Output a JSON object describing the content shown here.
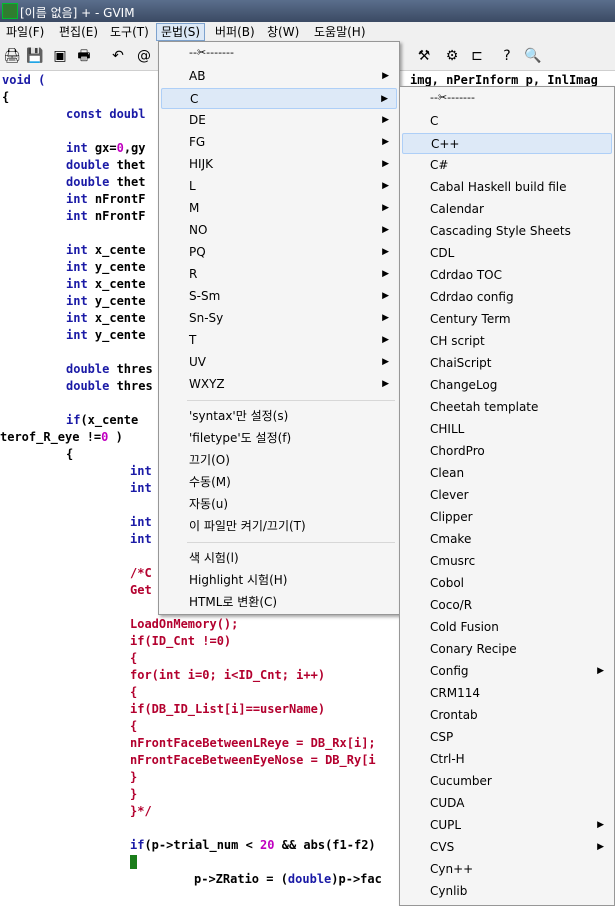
{
  "window": {
    "title": "[이름 없음] + - GVIM"
  },
  "menubar": [
    "파일(F)",
    "편집(E)",
    "도구(T)",
    "문법(S)",
    "버퍼(B)",
    "창(W)",
    "도움말(H)"
  ],
  "toolbar_icons": [
    "open-icon",
    "save-icon",
    "save-all-icon",
    "print-icon",
    "undo-icon",
    "redo-icon",
    "build-icon",
    "run-ctags-icon",
    "tag-jump-icon",
    "help-icon",
    "find-help-icon"
  ],
  "code": {
    "l1a": "void (",
    "l1b": "img, nPerInform p, InlImag",
    "l2": "{",
    "l3a": "const doubl",
    "l4a": "int",
    "l4b": " gx=",
    "l4c": "0",
    "l4d": ",gy",
    "l5a": "double",
    "l5b": " thet",
    "l6a": "double",
    "l6b": " thet",
    "l7a": "int",
    "l7b": " nFrontF",
    "l8a": "int",
    "l8b": " nFrontF",
    "l9a": "int",
    "l9b": " x_cente",
    "l10a": "int",
    "l10b": " y_cente",
    "l11a": "int",
    "l11b": " x_cente",
    "l12a": "int",
    "l12b": " y_cente",
    "l13a": "int",
    "l13b": " x_cente",
    "l14a": "int",
    "l14b": " y_cente",
    "l15a": "double",
    "l15b": " thres",
    "l16a": "double",
    "l16b": " thres",
    "l17a": "if",
    "l17b": "(x_cente",
    "l18a": "terof_R_eye !=",
    "l18b": "0",
    "l18c": " )",
    "l19": "{",
    "l20": "int",
    "l21": "int",
    "l22": "int",
    "l23": "int",
    "l24": "/*C",
    "l25": "Get",
    "l26": "LoadOnMemory();",
    "l27": "if(ID_Cnt !=0)",
    "l28": "{",
    "l29": "for(int i=0; i<ID_Cnt; i++)",
    "l30": "{",
    "l31": "if(DB_ID_List[i]==userName)",
    "l32": "{",
    "l33": "nFrontFaceBetweenLReye = DB_Rx[i];",
    "l34": "nFrontFaceBetweenEyeNose = DB_Ry[i",
    "l35": "}",
    "l36": "}",
    "l37": "}*/",
    "l38a": "if",
    "l38b": "(p->trial_num < ",
    "l38c": "20",
    "l38d": " && abs(f1-f2)",
    "l39": "{",
    "l40a": "p->ZRatio = (",
    "l40b": "double",
    "l40c": ")p->fac"
  },
  "syntax_menu": {
    "tearoff": "--✂-------",
    "items": [
      "AB",
      "C",
      "DE",
      "FG",
      "HIJK",
      "L",
      "M",
      "NO",
      "PQ",
      "R",
      "S-Sm",
      "Sn-Sy",
      "T",
      "UV",
      "WXYZ"
    ],
    "highlighted": "C",
    "actions1": [
      "'syntax'만 설정(s)",
      "'filetype'도 설정(f)",
      "끄기(O)",
      "수동(M)",
      "자동(u)",
      "이 파일만 켜기/끄기(T)"
    ],
    "actions2": [
      "색 시험(l)",
      "Highlight 시험(H)",
      "HTML로 변환(C)"
    ]
  },
  "c_submenu": {
    "tearoff": "--✂-------",
    "items": [
      "C",
      "C++",
      "C#",
      "Cabal Haskell build file",
      "Calendar",
      "Cascading Style Sheets",
      "CDL",
      "Cdrdao TOC",
      "Cdrdao config",
      "Century Term",
      "CH script",
      "ChaiScript",
      "ChangeLog",
      "Cheetah template",
      "CHILL",
      "ChordPro",
      "Clean",
      "Clever",
      "Clipper",
      "Cmake",
      "Cmusrc",
      "Cobol",
      "Coco/R",
      "Cold Fusion",
      "Conary Recipe",
      "Config",
      "CRM114",
      "Crontab",
      "CSP",
      "Ctrl-H",
      "Cucumber",
      "CUDA",
      "CUPL",
      "CVS",
      "Cyn++",
      "Cynlib"
    ],
    "submenu_items": [
      "Config",
      "CUPL",
      "CVS"
    ],
    "highlighted": "C++"
  }
}
